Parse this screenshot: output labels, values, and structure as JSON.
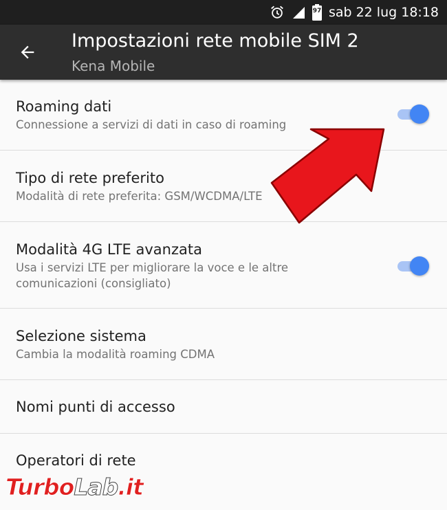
{
  "status_bar": {
    "time_text": "sab 22 lug 18:18",
    "battery_level": "97",
    "icons": [
      "alarm-icon",
      "signal-icon",
      "battery-icon"
    ]
  },
  "toolbar": {
    "title": "Impostazioni rete mobile SIM 2",
    "subtitle": "Kena Mobile",
    "back_icon": "arrow-back-icon"
  },
  "settings": [
    {
      "title": "Roaming dati",
      "summary": "Connessione a servizi di dati in caso di roaming",
      "toggle": true,
      "checked": true
    },
    {
      "title": "Tipo di rete preferito",
      "summary": "Modalità di rete preferita: GSM/WCDMA/LTE",
      "toggle": false
    },
    {
      "title": "Modalità 4G LTE avanzata",
      "summary": "Usa i servizi LTE per migliorare la voce e le altre comunicazioni (consigliato)",
      "toggle": true,
      "checked": true
    },
    {
      "title": "Selezione sistema",
      "summary": "Cambia la modalità roaming CDMA",
      "toggle": false
    },
    {
      "title": "Nomi punti di accesso",
      "summary": "",
      "toggle": false
    },
    {
      "title": "Operatori di rete",
      "summary": "",
      "toggle": false
    }
  ],
  "watermark": {
    "part1": "Turbo",
    "part2": "Lab",
    "part3": ".it"
  },
  "colors": {
    "toolbar": "#2e2e2e",
    "status_bar": "#1f1f1f",
    "switch_on": "#4285f4",
    "arrow": "#e8161c"
  }
}
